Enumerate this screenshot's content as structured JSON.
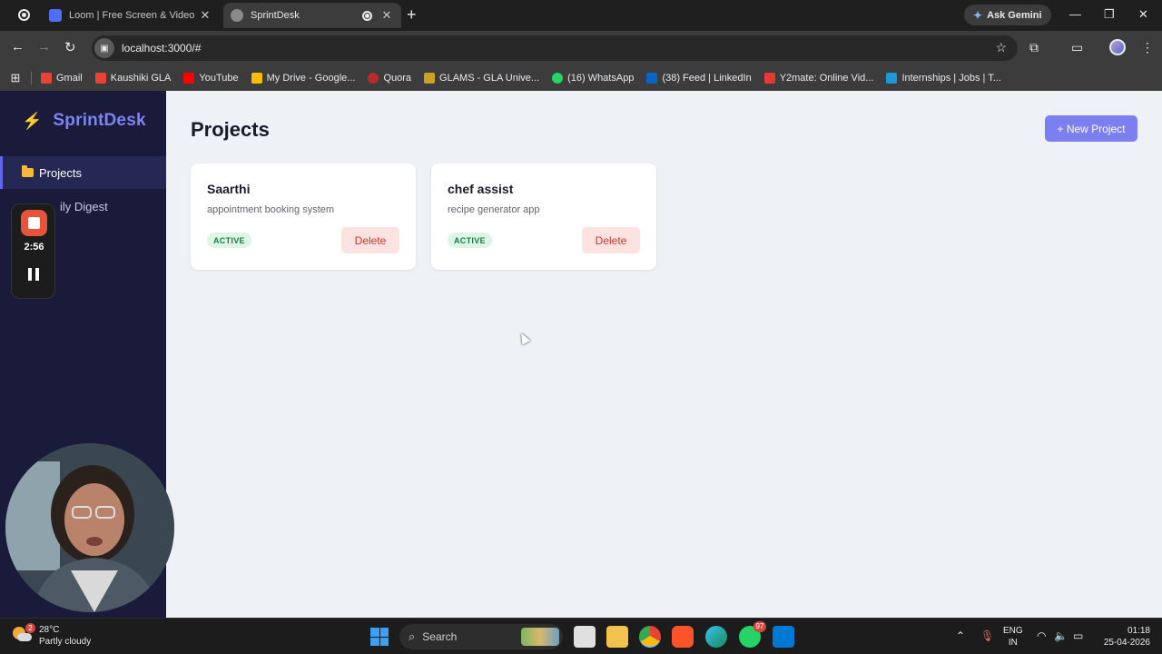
{
  "browser": {
    "tabs": [
      {
        "title": "Loom | Free Screen & Video Re"
      },
      {
        "title": "SprintDesk"
      }
    ],
    "new_tab": "+",
    "gemini_label": "Ask Gemini",
    "url": "localhost:3000/#",
    "bookmarks": [
      {
        "label": "Gmail",
        "color": "#ea4335"
      },
      {
        "label": "Kaushiki GLA",
        "color": "#ea4335"
      },
      {
        "label": "YouTube",
        "color": "#ff0000"
      },
      {
        "label": "My Drive - Google...",
        "color": "#fbbc04"
      },
      {
        "label": "Quora",
        "color": "#b92b27"
      },
      {
        "label": "GLAMS - GLA Unive...",
        "color": "#c9a227"
      },
      {
        "label": "(16) WhatsApp",
        "color": "#25d366"
      },
      {
        "label": "(38) Feed | LinkedIn",
        "color": "#0a66c2"
      },
      {
        "label": "Y2mate: Online Vid...",
        "color": "#e53935"
      },
      {
        "label": "Internships | Jobs | T...",
        "color": "#1a9bd7"
      }
    ]
  },
  "sidebar": {
    "brand": "SprintDesk",
    "items": [
      {
        "label": "Projects",
        "active": true
      },
      {
        "label": "ily Digest",
        "active": false
      }
    ]
  },
  "main": {
    "title": "Projects",
    "new_project_label": "+ New Project",
    "projects": [
      {
        "name": "Saarthi",
        "description": "appointment booking system",
        "status": "ACTIVE",
        "delete_label": "Delete"
      },
      {
        "name": "chef assist",
        "description": "recipe generator app",
        "status": "ACTIVE",
        "delete_label": "Delete"
      }
    ]
  },
  "loom": {
    "timer": "2:56"
  },
  "taskbar": {
    "weather_badge": "2",
    "temperature": "28°C",
    "weather": "Partly cloudy",
    "search_placeholder": "Search",
    "whatsapp_badge": "97",
    "lang_line1": "ENG",
    "lang_line2": "IN",
    "time": "01:18",
    "date": "25-04-2026"
  },
  "colors": {
    "accent": "#6366f1",
    "sidebar_bg": "#1a1b3a",
    "status_green": "#1e7b45",
    "danger": "#c0392b"
  }
}
